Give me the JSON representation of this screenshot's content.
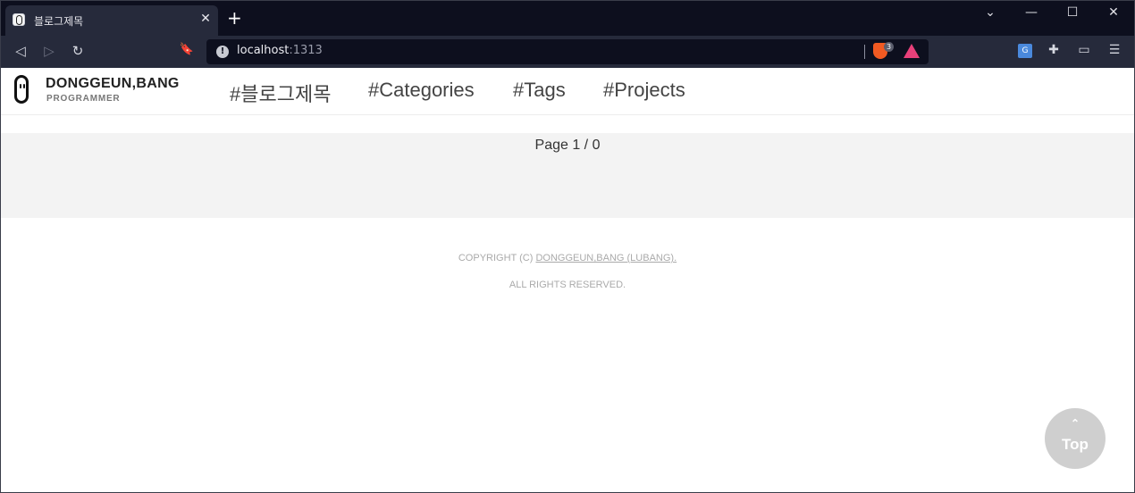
{
  "browser": {
    "tab": {
      "title": "블로그제목",
      "close_glyph": "✕"
    },
    "new_tab_glyph": "+",
    "window_controls": {
      "list": "⌄",
      "minimize": "—",
      "maximize": "☐",
      "close": "✕"
    },
    "nav": {
      "back": "◁",
      "forward": "▷",
      "reload": "↻",
      "bookmark": "🔖"
    },
    "address": {
      "host": "localhost",
      "port": ":1313",
      "info_glyph": "!"
    },
    "shields_count": "3",
    "extensions": {
      "translate": "G",
      "puzzle": "✚",
      "wallet": "▭",
      "menu": "☰"
    }
  },
  "site": {
    "brand": {
      "name": "DONGGEUN,BANG",
      "subtitle": "PROGRAMMER"
    },
    "menu": [
      {
        "label": "#블로그제목"
      },
      {
        "label": "#Categories"
      },
      {
        "label": "#Tags"
      },
      {
        "label": "#Projects"
      }
    ]
  },
  "content": {
    "page_indicator": "Page 1 / 0"
  },
  "footer": {
    "copyright_prefix": "COPYRIGHT (C) ",
    "copyright_link": "DONGGEUN,BANG (LUBANG).",
    "rights": "ALL RIGHTS RESERVED."
  },
  "top_button": {
    "chevron": "⌃",
    "label": "Top"
  },
  "colors": {
    "chrome_dark": "#0d0f1e",
    "chrome_toolbar": "#262a3b",
    "band": "#f3f3f3",
    "top_button": "#cfcfcf"
  }
}
